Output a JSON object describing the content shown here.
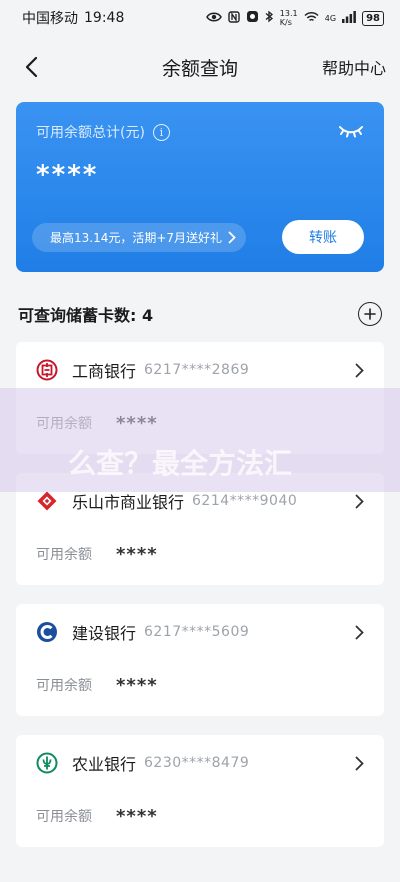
{
  "status": {
    "carrier": "中国移动",
    "time": "19:48",
    "net_speed": "13.1 K/s",
    "signal_label": "4G",
    "battery": "98"
  },
  "nav": {
    "title": "余额查询",
    "help": "帮助中心"
  },
  "balance_card": {
    "label": "可用余额总计(元)",
    "amount": "****",
    "promo": "最高13.14元，活期+7月送好礼",
    "transfer": "转账"
  },
  "section": {
    "title": "可查询储蓄卡数: 4"
  },
  "cards": [
    {
      "bank": "工商银行",
      "number": "6217****2869",
      "balance_label": "可用余额",
      "balance": "****"
    },
    {
      "bank": "乐山市商业银行",
      "number": "6214****9040",
      "balance_label": "可用余额",
      "balance": "****"
    },
    {
      "bank": "建设银行",
      "number": "6217****5609",
      "balance_label": "可用余额",
      "balance": "****"
    },
    {
      "bank": "农业银行",
      "number": "6230****8479",
      "balance_label": "可用余额",
      "balance": "****"
    }
  ],
  "watermark": {
    "text": "么查？最全方法汇"
  },
  "colors": {
    "accent": "#1f7ee6",
    "icbc": "#c7162b",
    "leshan": "#d6262c",
    "ccb": "#1b4f9c",
    "abc": "#0d8a62"
  }
}
